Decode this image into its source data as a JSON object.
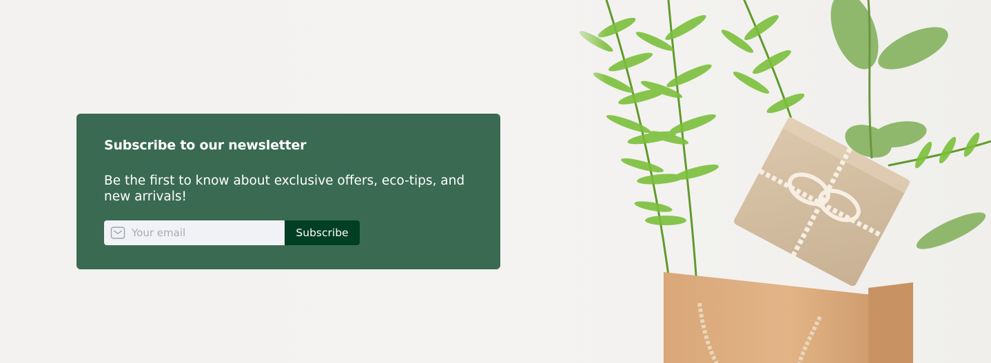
{
  "newsletter": {
    "title": "Subscribe to our newsletter",
    "description": "Be the first to know about exclusive offers, eco-tips, and new arrivals!",
    "email_placeholder": "Your email",
    "email_value": "",
    "icon": "mail-icon",
    "subscribe_label": "Subscribe"
  },
  "colors": {
    "card_background": "#3a6a52",
    "button_background": "#003f22",
    "input_background": "#f1f2f6",
    "page_background": "#f3f2f0"
  },
  "hero_image": {
    "description": "fern leaves with kraft gift box in paper bag"
  }
}
